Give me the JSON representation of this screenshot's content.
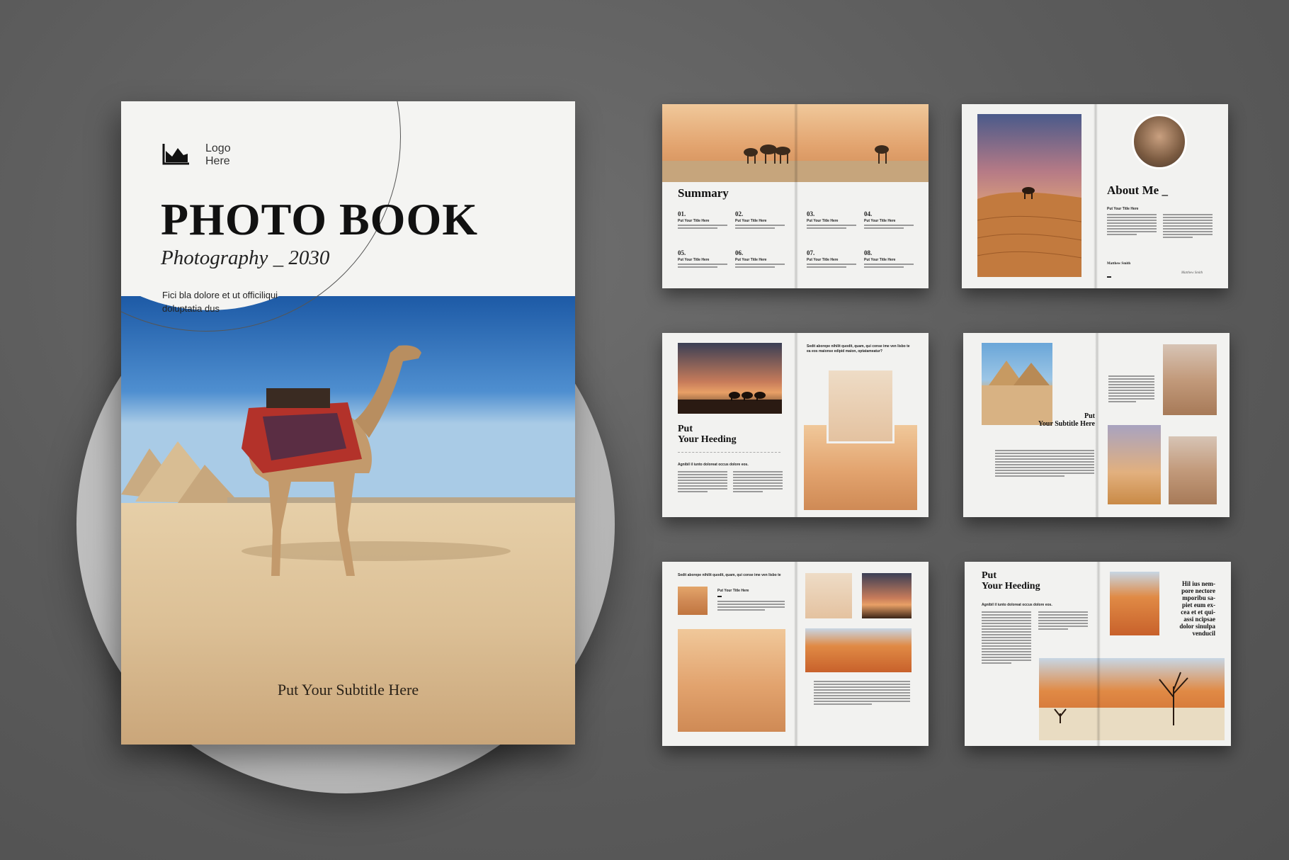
{
  "cover": {
    "logo_text": "Logo\nHere",
    "title": "PHOTO BOOK",
    "subtitle": "Photography _ 2030",
    "description": "Fici bla dolore et ut officiliqui doluptatia dus",
    "bottom_subtitle": "Put Your Subtitle Here"
  },
  "spread1": {
    "heading": "Summary",
    "items": [
      {
        "num": "01.",
        "title": "Put Your Title Here"
      },
      {
        "num": "02.",
        "title": "Put Your Title Here"
      },
      {
        "num": "03.",
        "title": "Put Your Title Here"
      },
      {
        "num": "04.",
        "title": "Put Your Title Here"
      },
      {
        "num": "05.",
        "title": "Put Your Title Here"
      },
      {
        "num": "06.",
        "title": "Put Your Title Here"
      },
      {
        "num": "07.",
        "title": "Put Your Title Here"
      },
      {
        "num": "08.",
        "title": "Put Your Title Here"
      }
    ]
  },
  "spread2": {
    "heading": "About Me _",
    "small_title": "Put Your Title Here",
    "name": "Matthew Smith",
    "signature": "Matthew Smith"
  },
  "spread3": {
    "heading": "Put\nYour Heeding",
    "lead": "Agnibil il iunto doloreat occus dolore eos.",
    "quote": "Sedit aborepe nihilit quodit, quam, qui conse ime ven lisbo te ea eos maionse edipid maion, optatameatur?"
  },
  "spread4": {
    "heading": "Put\nYour Subtitle Here"
  },
  "spread5": {
    "quote": "Sedit aborepe nihilit quodit, quam, qui conse ime ven lisbo te",
    "small_title": "Put Your Title Here"
  },
  "spread6": {
    "heading": "Put\nYour Heeding",
    "lead": "Agnibil il iunto doloreat occus dolore eos.",
    "pull_quote": "Hil ius nem-\npore nectore\nmporibu sa-\npiet eum ex-\ncea et et qui-\nassi ncipsae\ndolor sinulpa\nvenducil"
  },
  "colors": {
    "background": "#5b5b5b",
    "paper": "#f4f4f2",
    "ink": "#111111"
  }
}
